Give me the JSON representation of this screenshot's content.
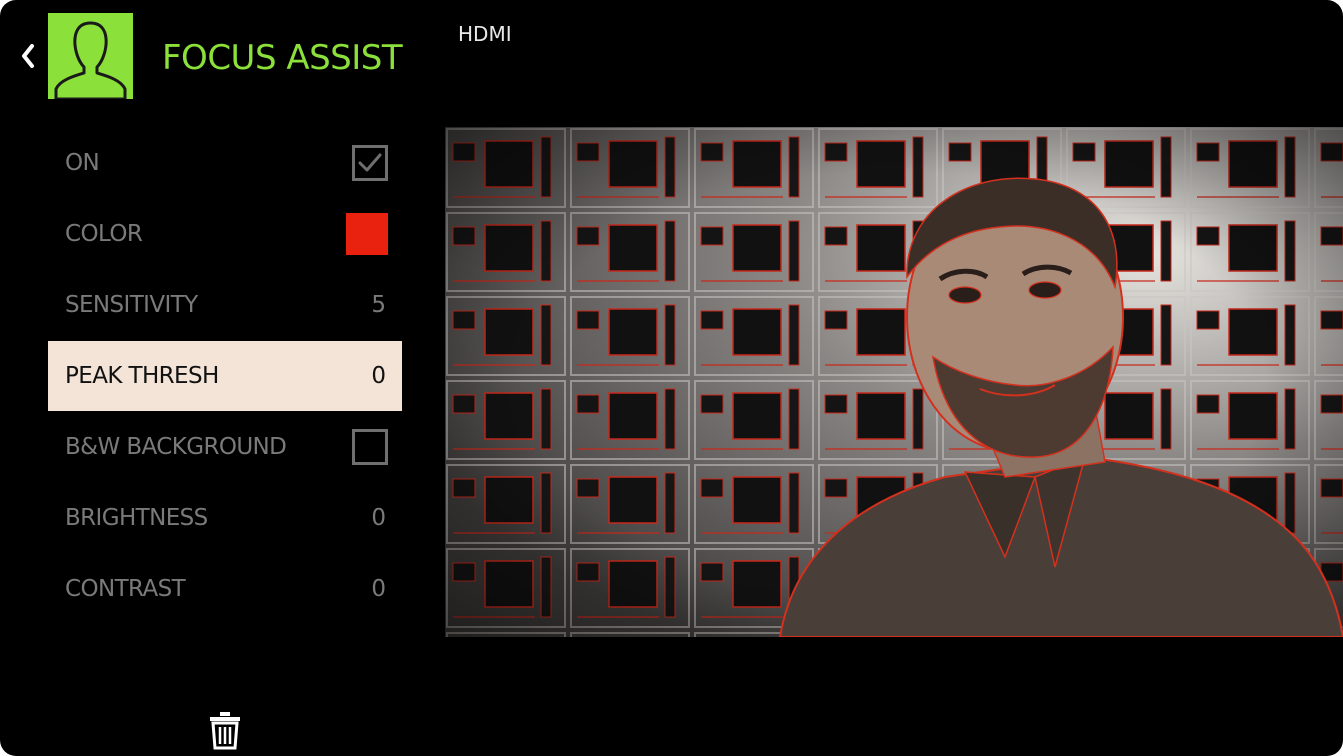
{
  "header": {
    "title": "FOCUS ASSIST",
    "source": "HDMI",
    "back_icon": "chevron-left-icon",
    "avatar_icon": "person-silhouette-icon"
  },
  "menu": {
    "on": {
      "label": "ON",
      "checked": true
    },
    "color": {
      "label": "COLOR",
      "value_color": "#e8220f"
    },
    "sensitivity": {
      "label": "SENSITIVITY",
      "value": "5"
    },
    "peak_thresh": {
      "label": "PEAK THRESH",
      "value": "0"
    },
    "bw_background": {
      "label": "B&W BACKGROUND",
      "checked": false
    },
    "brightness": {
      "label": "BRIGHTNESS",
      "value": "0"
    },
    "contrast": {
      "label": "CONTRAST",
      "value": "0"
    }
  },
  "footer": {
    "delete_icon": "trash-icon"
  },
  "colors": {
    "accent": "#8be03a",
    "selected_row": "#f4e4d8",
    "peaking": "#e8220f"
  }
}
